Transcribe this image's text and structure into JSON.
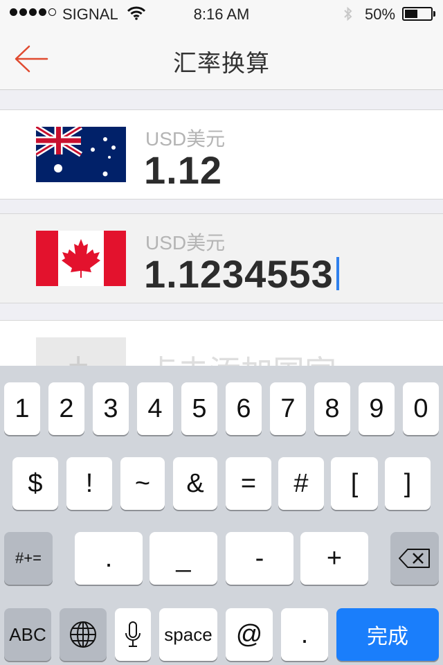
{
  "status_bar": {
    "carrier": "SIGNAL",
    "time": "8:16 AM",
    "battery": "50%",
    "battery_level": 0.5,
    "signal_bars": 4,
    "icons": [
      "wifi-icon",
      "bluetooth-icon",
      "battery-icon"
    ]
  },
  "nav": {
    "title": "汇率换算",
    "back_icon": "arrow-left-icon",
    "accent_color": "#e04a2f"
  },
  "currencies": [
    {
      "flag": "australia-flag",
      "label": "USD美元",
      "value": "1.12"
    },
    {
      "flag": "canada-flag",
      "label": "USD美元",
      "value": "1.1234553"
    }
  ],
  "add_country": {
    "icon": "plus-icon",
    "label": "点击添加国家"
  },
  "keyboard": {
    "row1": [
      "1",
      "2",
      "3",
      "4",
      "5",
      "6",
      "7",
      "8",
      "9",
      "0"
    ],
    "row2": [
      "$",
      "!",
      "~",
      "&",
      "=",
      "#",
      "[",
      "]"
    ],
    "row3": {
      "mode": "#+=",
      "keys": [
        ".",
        "_",
        "-",
        "+"
      ],
      "delete_icon": "backspace-icon"
    },
    "row4": {
      "abc": "ABC",
      "globe_icon": "globe-icon",
      "mic_icon": "microphone-icon",
      "space": "space",
      "at": "@",
      "dot": ".",
      "done": "完成"
    },
    "done_color": "#1a7efb"
  }
}
